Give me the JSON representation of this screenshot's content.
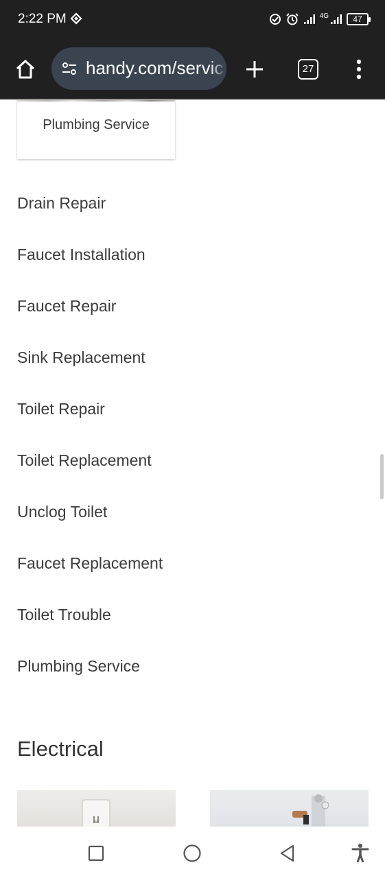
{
  "status_bar": {
    "time": "2:22 PM",
    "network_label": "4G",
    "battery": "47",
    "icons": [
      "sync-icon",
      "screen-record-icon",
      "alarm-icon",
      "signal-icon",
      "signal-4g-icon",
      "battery-icon"
    ]
  },
  "toolbar": {
    "url": "handy.com/servic",
    "tab_count": "27",
    "icons": [
      "home-icon",
      "site-settings-icon",
      "add-icon",
      "more-vert-icon"
    ]
  },
  "card": {
    "title": "Plumbing Service"
  },
  "services": [
    "Drain Repair",
    "Faucet Installation",
    "Faucet Repair",
    "Sink Replacement",
    "Toilet Repair",
    "Toilet Replacement",
    "Unclog Toilet",
    "Faucet Replacement",
    "Toilet Trouble",
    "Plumbing Service"
  ],
  "section": {
    "title": "Electrical"
  },
  "navbar": {
    "icons": [
      "recents-icon",
      "home-circle-icon",
      "back-icon",
      "accessibility-icon"
    ]
  },
  "colors": {
    "bar_bg": "#202020",
    "url_pill_bg": "#3a4350",
    "text_primary": "#3c3c3c"
  }
}
